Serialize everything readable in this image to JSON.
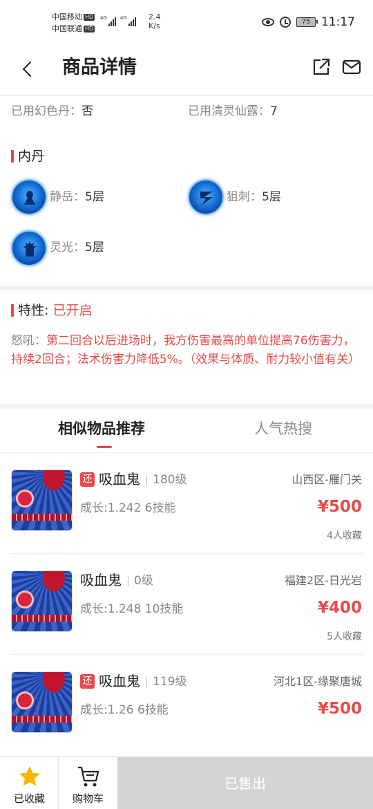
{
  "status_bar": {
    "carrier1": "中国移动",
    "carrier2": "中国联通",
    "hd": "HD",
    "net1": "4G",
    "net2": "4G",
    "speed_value": "2.4",
    "speed_unit": "K/s",
    "battery": "75",
    "time": "11:17"
  },
  "header": {
    "title": "商品详情"
  },
  "basic": {
    "item1_key": "已用幻色丹：",
    "item1_value": "否",
    "item2_key": "已用清灵仙露：",
    "item2_value": "7"
  },
  "neidan": {
    "title": "内丹",
    "items": [
      {
        "name": "静岳：",
        "value": "5层"
      },
      {
        "name": "狙刺：",
        "value": "5层"
      },
      {
        "name": "灵光：",
        "value": "5层"
      }
    ]
  },
  "trait": {
    "title": "特性:",
    "status": "已开启",
    "desc_key": "怒吼：",
    "desc": "第二回合以后进场时，我方伤害最高的单位提高76伤害力，持续2回合；法术伤害力降低5%。（效果与体质、耐力较小值有关）"
  },
  "recommend": {
    "tabs": [
      "相似物品推荐",
      "人气热搜"
    ],
    "badge": "还",
    "items": [
      {
        "name": "吸血鬼",
        "level": "180级",
        "server": "山西区-雁门关",
        "growth": "成长:1.242 6技能",
        "price": "¥500",
        "favs": "4人收藏"
      },
      {
        "name": "吸血鬼",
        "level": "0级",
        "server": "福建2区-日光岩",
        "growth": "成长:1.248 10技能",
        "price": "¥400",
        "favs": "5人收藏"
      },
      {
        "name": "吸血鬼",
        "level": "119级",
        "server": "河北1区-缘聚唐城",
        "growth": "成长:1.26 6技能",
        "price": "¥500",
        "favs": ""
      }
    ]
  },
  "bottom": {
    "fav_label": "已收藏",
    "cart_label": "购物车",
    "sold_label": "已售出"
  },
  "colors": {
    "accent": "#e94a4a",
    "star": "#f5b800",
    "sold_bg": "#d4d4d4"
  }
}
